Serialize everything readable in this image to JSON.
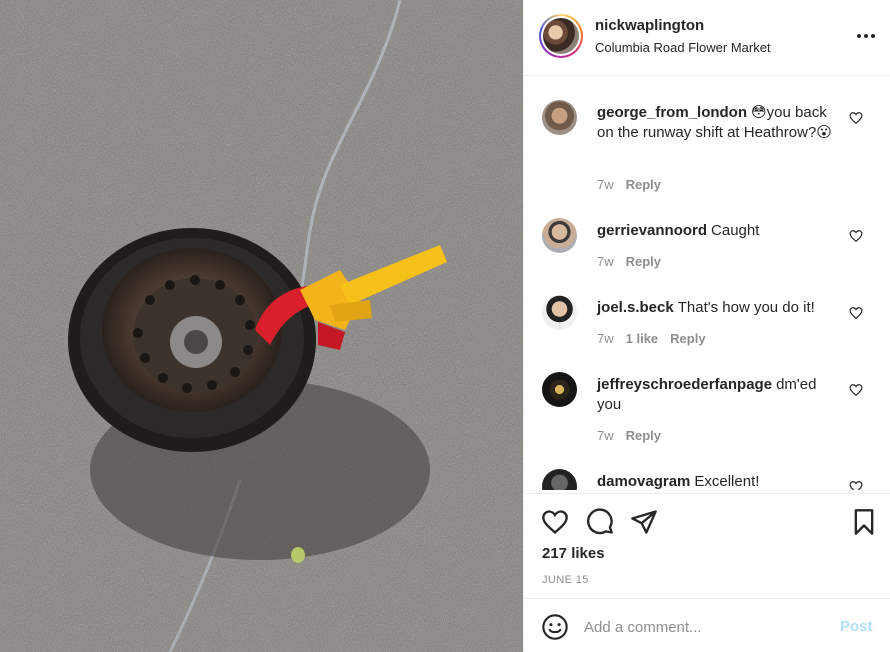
{
  "post": {
    "username": "nickwaplington",
    "location": "Columbia Road Flower Market",
    "more_icon": "more-horizontal-icon"
  },
  "comments": [
    {
      "username": "george_from_london",
      "text": "😳you back on the runway shift at Heathrow?😮",
      "time": "7w",
      "likes": "",
      "reply": "Reply"
    },
    {
      "username": "gerrievannoord",
      "text": "Caught",
      "time": "7w",
      "likes": "",
      "reply": "Reply"
    },
    {
      "username": "joel.s.beck",
      "text": "That's how you do it!",
      "time": "7w",
      "likes": "1 like",
      "reply": "Reply"
    },
    {
      "username": "jeffreyschroederfanpage",
      "text": "dm'ed you",
      "time": "7w",
      "likes": "",
      "reply": "Reply"
    },
    {
      "username": "damovagram",
      "text": "Excellent!",
      "time": "",
      "likes": "",
      "reply": ""
    }
  ],
  "actions": {
    "like_icon": "heart-icon",
    "comment_icon": "comment-icon",
    "share_icon": "share-icon",
    "save_icon": "bookmark-icon",
    "likes_count": "217 likes",
    "date": "JUNE 15"
  },
  "add_comment": {
    "emoji_icon": "emoji-icon",
    "placeholder": "Add a comment...",
    "post_label": "Post"
  },
  "colors": {
    "link_disabled": "#b2dffc",
    "muted": "#8e8e8e",
    "text": "#262626",
    "border": "#efefef"
  }
}
